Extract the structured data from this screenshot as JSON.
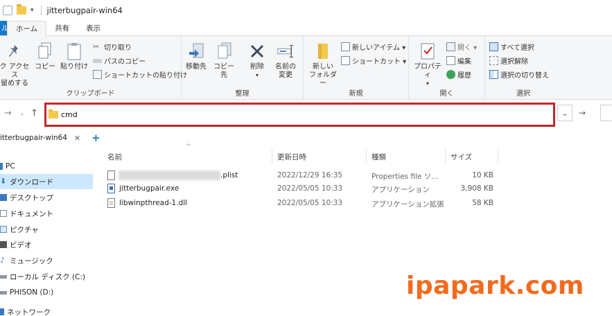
{
  "window": {
    "title": "jitterbugpair-win64"
  },
  "ribbon_tabs": [
    {
      "label": "ル"
    },
    {
      "label": "ホーム"
    },
    {
      "label": "共有"
    },
    {
      "label": "表示"
    }
  ],
  "ribbon": {
    "clipboard": {
      "pin_line1": "ク アクセス",
      "pin_line2": "留めする",
      "copy": "コピー",
      "paste": "貼り付け",
      "cut": "切り取り",
      "copy_path": "パスのコピー",
      "paste_shortcut": "ショートカットの貼り付け",
      "label": "クリップボード"
    },
    "organize": {
      "move_to": "移動先",
      "copy_to": "コピー先",
      "delete": "削除",
      "rename_line1": "名前の",
      "rename_line2": "変更",
      "label": "整理"
    },
    "new": {
      "new_folder_line1": "新しい",
      "new_folder_line2": "フォルダー",
      "new_item": "新しいアイテム ▾",
      "shortcut": "ショートカット ▾",
      "label": "新規"
    },
    "open": {
      "properties": "プロパティ",
      "open": "開く ▾",
      "edit": "編集",
      "history": "履歴",
      "label": "開く"
    },
    "select": {
      "select_all": "すべて選択",
      "select_none": "選択解除",
      "invert": "選択の切り替え",
      "label": "選択"
    }
  },
  "address": {
    "value": "cmd"
  },
  "folder_tab": {
    "label": "itterbugpair-win64",
    "close": "✕",
    "add": "+"
  },
  "nav_pane": [
    {
      "label": "PC",
      "icon": "pc-icon"
    },
    {
      "label": "ダウンロード",
      "icon": "download-icon",
      "selected": true
    },
    {
      "label": "デスクトップ",
      "icon": "desktop-icon"
    },
    {
      "label": "ドキュメント",
      "icon": "documents-icon"
    },
    {
      "label": "ピクチャ",
      "icon": "pictures-icon"
    },
    {
      "label": "ビデオ",
      "icon": "videos-icon"
    },
    {
      "label": "ミュージック",
      "icon": "music-icon"
    },
    {
      "label": "ローカル ディスク (C:)",
      "icon": "drive-icon"
    },
    {
      "label": "PHISON (D:)",
      "icon": "drive-icon"
    },
    {
      "label": "ネットワーク",
      "icon": "network-icon"
    }
  ],
  "columns": {
    "name": "名前",
    "date": "更新日時",
    "type": "種類",
    "size": "サイズ"
  },
  "files": [
    {
      "name": ".plist",
      "date": "2022/12/29 16:35",
      "type": "Properties file ソ...",
      "size": "10 KB",
      "icon": "file-icon"
    },
    {
      "name": "jitterbugpair.exe",
      "date": "2022/05/05 10:33",
      "type": "アプリケーション",
      "size": "3,908 KB",
      "icon": "exe-icon"
    },
    {
      "name": "libwinpthread-1.dll",
      "date": "2022/05/05 10:33",
      "type": "アプリケーション拡張",
      "size": "58 KB",
      "icon": "dll-icon"
    }
  ],
  "watermark": "ipapark.com"
}
